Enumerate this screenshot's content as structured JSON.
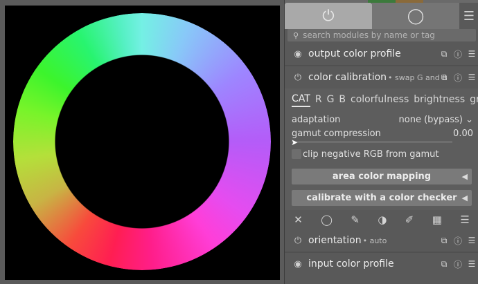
{
  "image": {
    "colors": {
      "background": "#000000",
      "ring_hues": [
        "#74f0e4",
        "#9d86ff",
        "#ff3ed8",
        "#ff1e52",
        "#b4e03a",
        "#3cf42c"
      ]
    }
  },
  "tabs": {
    "active_icon": "power-icon",
    "active_glyph": "⏻",
    "all_icon": "circle-icon",
    "all_glyph": "◯",
    "presets_icon": "hamburger-menu-icon",
    "presets_glyph": "☰"
  },
  "search": {
    "icon": "search-icon",
    "icon_glyph": "⚲",
    "placeholder": "search modules by name or tag"
  },
  "modules": {
    "output": {
      "title": "output color profile",
      "label": "",
      "power_glyph": "◉"
    },
    "colorcal": {
      "title": "color calibration",
      "label": "• swap G and B",
      "power_glyph": "⏻"
    },
    "orientation": {
      "title": "orientation",
      "label": "• auto",
      "power_glyph": "⏻"
    },
    "input": {
      "title": "input color profile",
      "label": "",
      "power_glyph": "◉"
    },
    "header_icons": {
      "multi": "⧉",
      "reset": "ⓘ",
      "presets": "☰"
    }
  },
  "color_calibration": {
    "tabs": [
      "CAT",
      "R",
      "G",
      "B",
      "colorfulness",
      "brightness",
      "gray"
    ],
    "active_tab": "CAT",
    "adaptation_label": "adaptation",
    "adaptation_value": "none (bypass)",
    "adaptation_arrow": "⌄",
    "gamut_label": "gamut compression",
    "gamut_value": "0.00",
    "clip_label": "clip negative RGB from gamut",
    "area_mapping_button": "area color mapping",
    "checker_button": "calibrate with a color checker",
    "button_arrow": "◀"
  },
  "blend_bar": {
    "icons": [
      {
        "name": "blend-off-icon",
        "glyph": "✕"
      },
      {
        "name": "blend-uniform-icon",
        "glyph": "◯"
      },
      {
        "name": "blend-drawn-mask-icon",
        "glyph": "✎"
      },
      {
        "name": "blend-parametric-mask-icon",
        "glyph": "◑"
      },
      {
        "name": "blend-drawn-parametric-icon",
        "glyph": "✐"
      },
      {
        "name": "blend-raster-mask-icon",
        "glyph": "▦"
      },
      {
        "name": "blend-menu-icon",
        "glyph": "☰"
      }
    ]
  }
}
